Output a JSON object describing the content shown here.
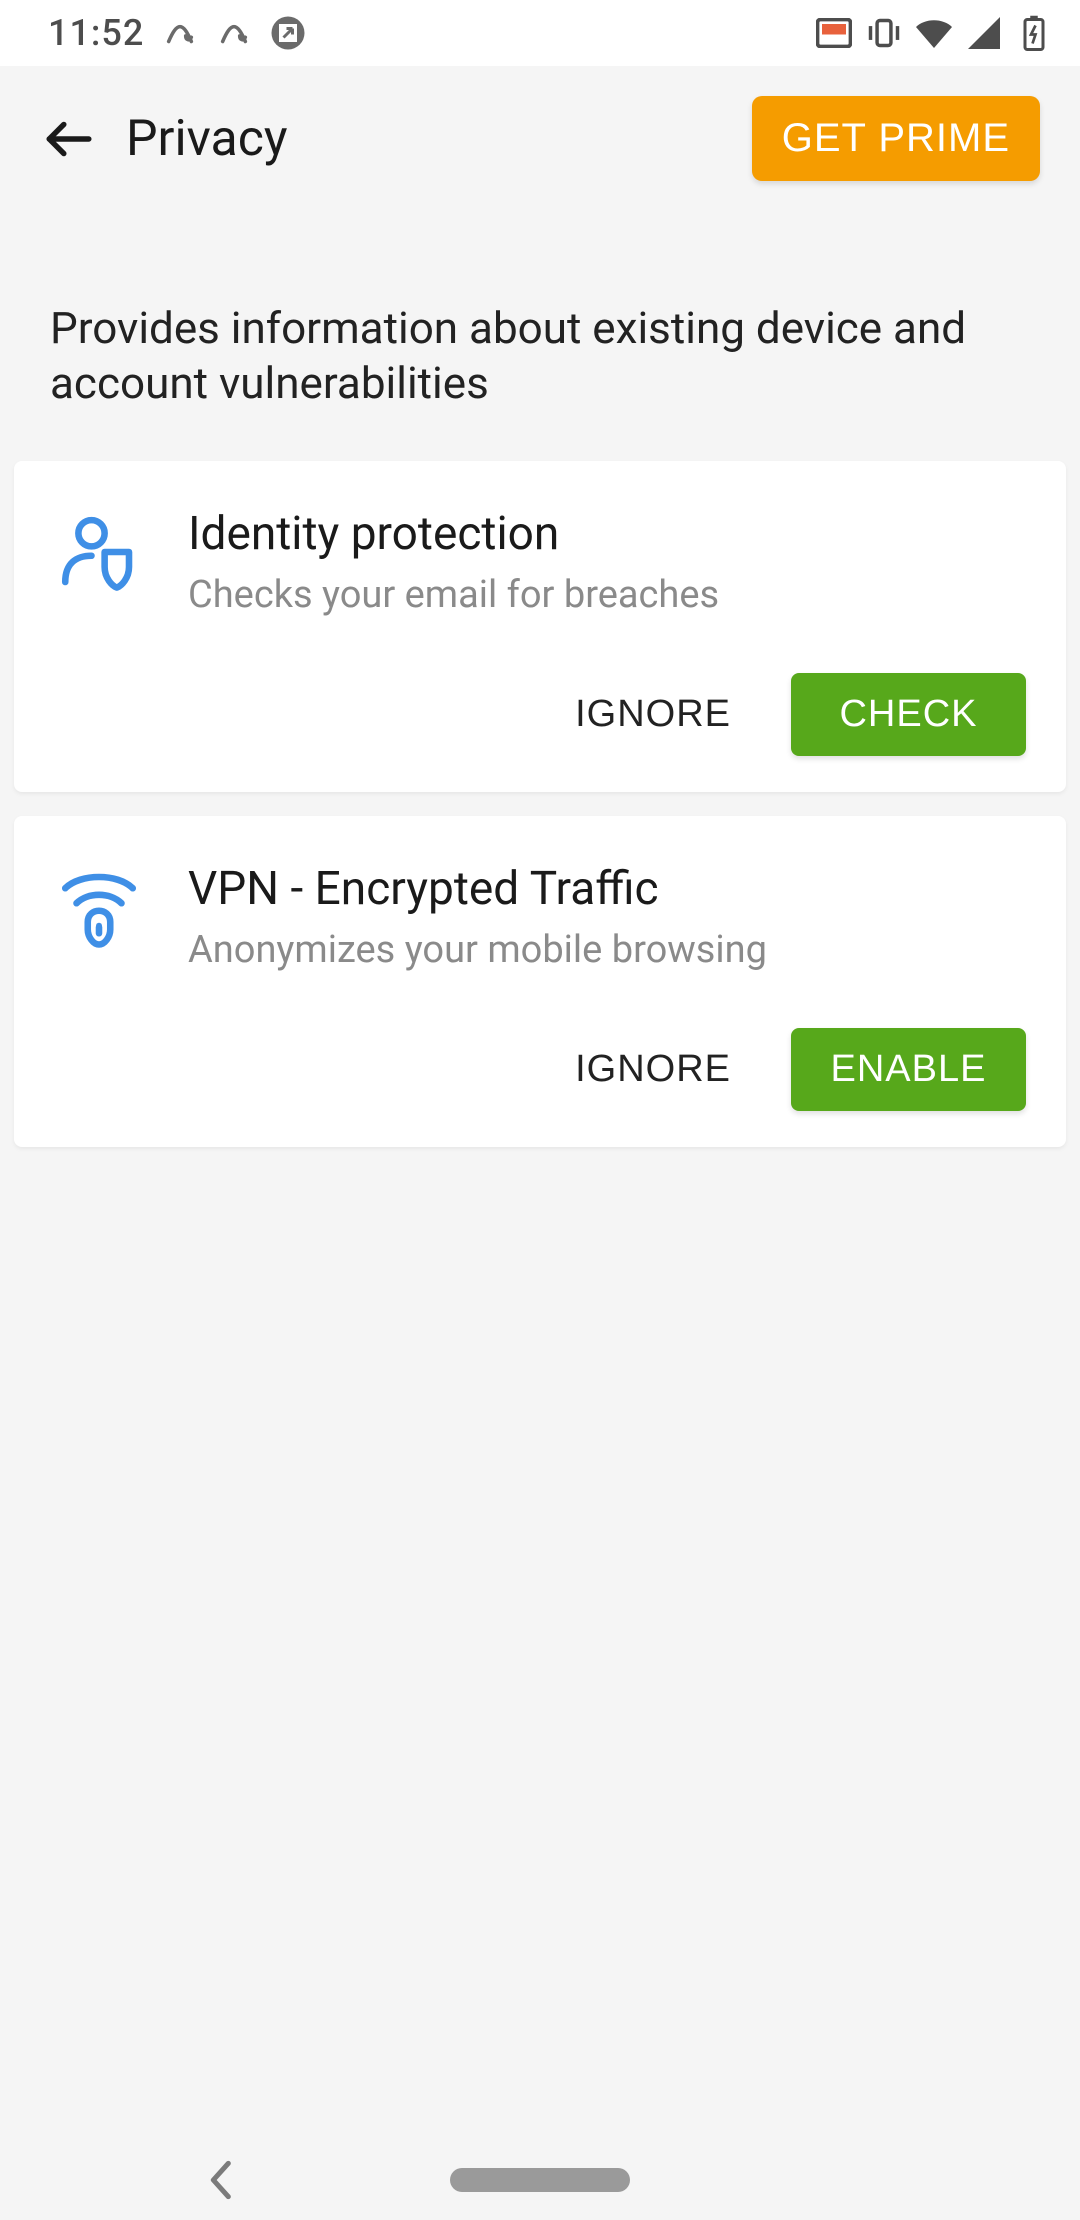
{
  "status_bar": {
    "time": "11:52",
    "left_icons": [
      "avira-icon",
      "avira-icon",
      "app-badge-icon"
    ],
    "right_icons": [
      "cast-icon",
      "vibrate-icon",
      "wifi-icon",
      "signal-icon",
      "battery-charging-icon"
    ]
  },
  "header": {
    "title": "Privacy",
    "prime_button": "GET PRIME"
  },
  "page_description": "Provides information about existing device and account vulnerabilities",
  "cards": [
    {
      "icon": "identity-shield-icon",
      "title": "Identity protection",
      "desc": "Checks your email for breaches",
      "ignore_label": "IGNORE",
      "action_label": "CHECK"
    },
    {
      "icon": "vpn-lock-icon",
      "title": "VPN - Encrypted Traffic",
      "desc": "Anonymizes your mobile browsing",
      "ignore_label": "IGNORE",
      "action_label": "ENABLE"
    }
  ],
  "colors": {
    "accent_orange": "#f59c00",
    "accent_green": "#57a81b",
    "icon_blue": "#4a90e2",
    "bg_grey": "#f5f5f5"
  }
}
